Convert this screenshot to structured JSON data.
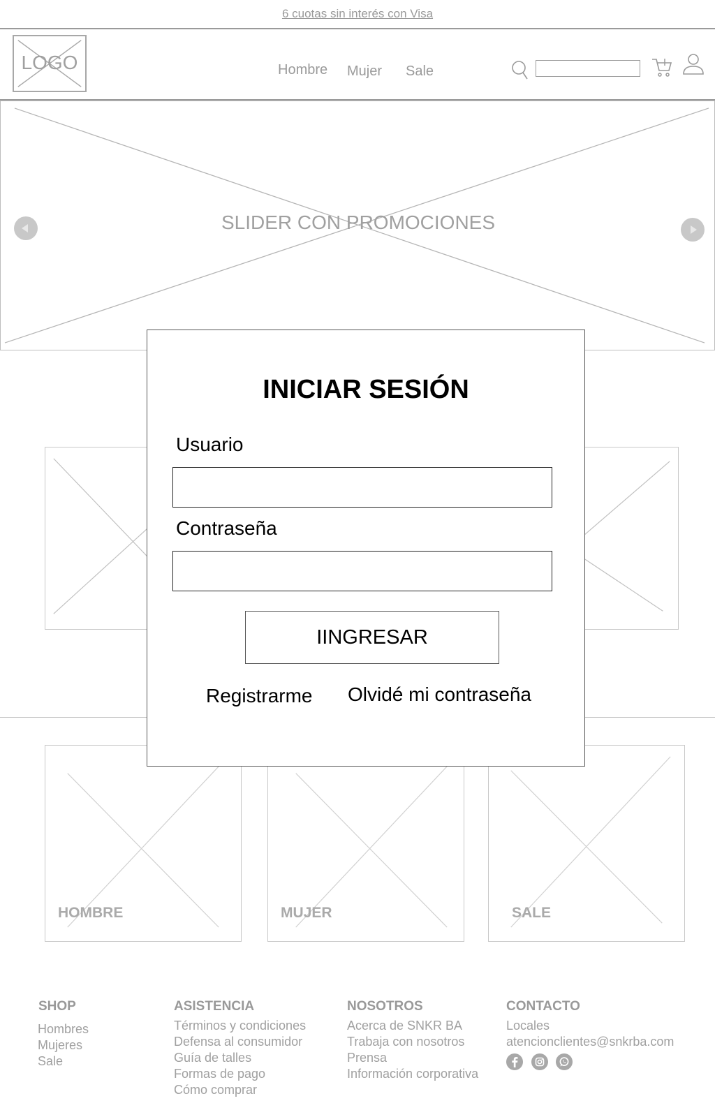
{
  "promo_bar": {
    "text": "6 cuotas sin interés con Visa"
  },
  "header": {
    "logo": "LOGO",
    "nav": [
      "Hombre",
      "Mujer",
      "Sale"
    ],
    "search_value": ""
  },
  "hero": {
    "label": "SLIDER CON PROMOCIONES"
  },
  "categories": [
    "HOMBRE",
    "MUJER",
    "SALE"
  ],
  "login_modal": {
    "title": "INICIAR SESIÓN",
    "user_label": "Usuario",
    "user_value": "",
    "password_label": "Contraseña",
    "password_value": "",
    "submit_label": "IINGRESAR",
    "register_link": "Registrarme",
    "forgot_link": "Olvidé mi contraseña"
  },
  "footer": {
    "columns": [
      {
        "heading": "SHOP",
        "items": [
          "Hombres",
          "Mujeres",
          "Sale"
        ]
      },
      {
        "heading": "ASISTENCIA",
        "items": [
          "Términos y condiciones",
          "Defensa al consumidor",
          "Guía de talles",
          "Formas de pago",
          "Cómo comprar"
        ]
      },
      {
        "heading": "NOSOTROS",
        "items": [
          "Acerca de SNKR BA",
          "Trabaja con nosotros",
          "Prensa",
          "Información corporativa"
        ]
      },
      {
        "heading": "CONTACTO",
        "items": [
          "Locales",
          "atencionclientes@snkrba.com"
        ]
      }
    ],
    "social_icons": [
      "facebook-icon",
      "instagram-icon",
      "whatsapp-icon"
    ]
  },
  "colors": {
    "wire": "#9a9a9a",
    "placeholder_line": "#c8c8c8",
    "modal_border": "#555555",
    "text_dark": "#000000"
  }
}
